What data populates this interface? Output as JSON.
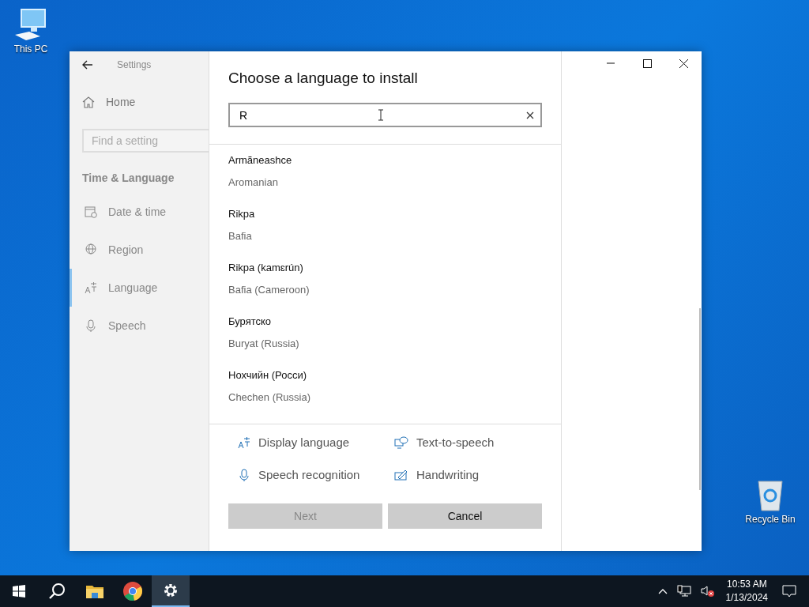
{
  "desktop": {
    "icons": [
      {
        "label": "This PC",
        "kind": "pc"
      },
      {
        "label": "Recycle Bin",
        "kind": "bin"
      }
    ]
  },
  "window": {
    "title": "Settings"
  },
  "sidebar": {
    "home": "Home",
    "search": {
      "placeholder": "Find a setting"
    },
    "section": "Time & Language",
    "items": [
      {
        "label": "Date & time",
        "kind": "date",
        "selected": false
      },
      {
        "label": "Region",
        "kind": "region",
        "selected": false
      },
      {
        "label": "Language",
        "kind": "language",
        "selected": true
      },
      {
        "label": "Speech",
        "kind": "speech",
        "selected": false
      }
    ]
  },
  "dialog": {
    "title": "Choose a language to install",
    "search": {
      "value": "R"
    },
    "languages": [
      {
        "name": "Armãneashce",
        "english": "Aromanian"
      },
      {
        "name": "Rikpa",
        "english": "Bafia"
      },
      {
        "name": "Rikpa (kamɛrún)",
        "english": "Bafia (Cameroon)"
      },
      {
        "name": "Бурятско",
        "english": "Buryat (Russia)"
      },
      {
        "name": "Нохчийн (Росси)",
        "english": "Chechen (Russia)"
      }
    ],
    "features": [
      {
        "label": "Display language",
        "kind": "display"
      },
      {
        "label": "Text-to-speech",
        "kind": "tts"
      },
      {
        "label": "Speech recognition",
        "kind": "speech"
      },
      {
        "label": "Handwriting",
        "kind": "handwriting"
      }
    ],
    "buttons": [
      {
        "label": "Next",
        "disabled": true
      },
      {
        "label": "Cancel",
        "disabled": false
      }
    ]
  },
  "taskbar": {
    "apps": [
      {
        "kind": "start",
        "selected": false
      },
      {
        "kind": "search",
        "selected": false
      },
      {
        "kind": "folder",
        "selected": false
      },
      {
        "kind": "browser",
        "selected": false
      },
      {
        "kind": "settings",
        "selected": true
      }
    ],
    "time": "10:53 AM",
    "date": "1/13/2024"
  }
}
